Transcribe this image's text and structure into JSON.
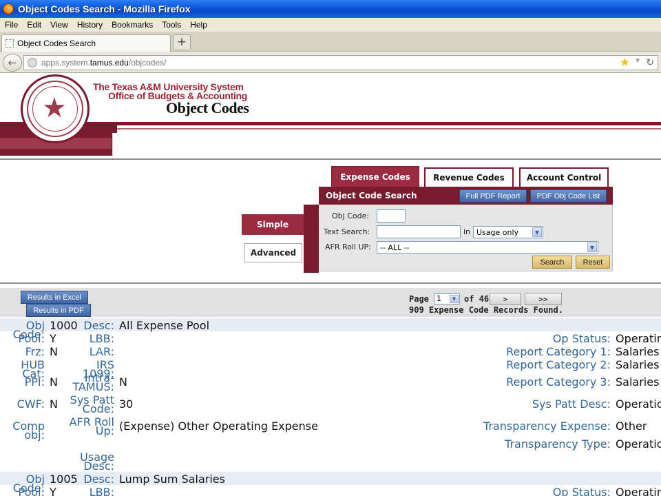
{
  "window": {
    "title": "Object Codes Search - Mozilla Firefox"
  },
  "menu": [
    "File",
    "Edit",
    "View",
    "History",
    "Bookmarks",
    "Tools",
    "Help"
  ],
  "tab": {
    "title": "Object Codes Search",
    "new_tab": "+"
  },
  "url": {
    "prefix": "apps.system.",
    "domain": "tamus.edu",
    "path": "/objcodes/"
  },
  "header": {
    "line1": "The Texas A&M University System",
    "line2": "Office of Budgets & Accounting",
    "line3": "Object Codes"
  },
  "top_tabs": {
    "expense": "Expense Codes",
    "revenue": "Revenue Codes",
    "account": "Account Control"
  },
  "search": {
    "title": "Object Code Search",
    "full_pdf": "Full PDF Report",
    "pdf_list": "PDF Obj Code List",
    "obj_code_label": "Obj Code:",
    "text_search_label": "Text Search:",
    "in_label": "in",
    "in_option": "Usage only",
    "afr_label": "AFR Roll UP:",
    "afr_option": "-- ALL --",
    "search_btn": "Search",
    "reset_btn": "Reset",
    "simple": "Simple",
    "advanced": "Advanced"
  },
  "results": {
    "excel": "Results in Excel",
    "pdf": "Results in PDF",
    "page_label": "Page",
    "page_value": "1",
    "of_label": "of 46",
    "next": ">",
    "last": ">>",
    "found": "909 Expense Code Records Found."
  },
  "labels": {
    "obj_code": "Obj Code:",
    "desc": "Desc:",
    "pool": "Pool:",
    "lbb": "LBB:",
    "op_status": "Op Status:",
    "frz": "Frz:",
    "lar": "LAR:",
    "rc1": "Report Category 1:",
    "hub": "HUB Cat:",
    "irs": "IRS 1099:",
    "rc2": "Report Category 2:",
    "ppi": "PPI:",
    "intra": "Intra-TAMUS:",
    "rc3": "Report Category 3:",
    "cwf": "CWF:",
    "spc": "Sys Patt Code:",
    "spd": "Sys Patt Desc:",
    "comp": "Comp obj:",
    "afr": "AFR Roll Up:",
    "te": "Transparency Expense:",
    "tt": "Transparency Type:",
    "usage": "Usage Desc:"
  },
  "records": [
    {
      "obj_code": "1000",
      "desc": "All Expense Pool",
      "pool": "Y",
      "op_status": "Operating",
      "frz": "N",
      "rc1": "Salaries and",
      "rc2": "Salaries and",
      "ppi": "N",
      "intra": "N",
      "rc3": "Salaries and",
      "cwf": "N",
      "spc": "30",
      "spd": "Operations",
      "afr": "(Expense) Other Operating Expense",
      "te": "Other",
      "tt": "Operations"
    },
    {
      "obj_code": "1005",
      "desc": "Lump Sum Salaries",
      "pool": "Y",
      "op_status": "Operating"
    }
  ]
}
